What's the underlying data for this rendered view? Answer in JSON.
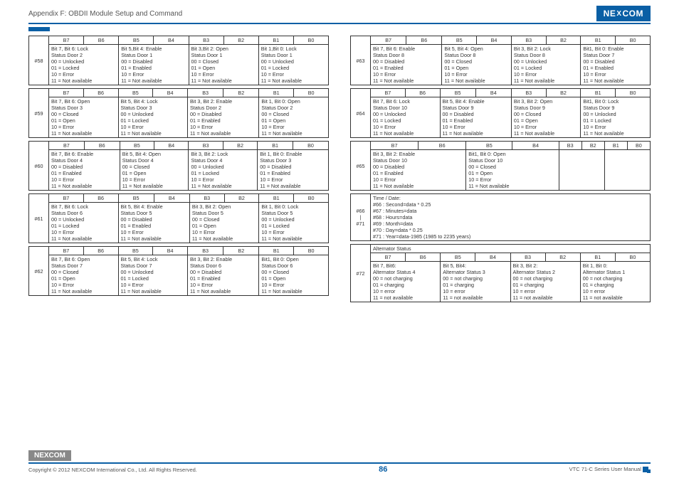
{
  "header": {
    "breadcrumb": "Appendix F: OBDII Module Setup and Command",
    "logo": "NE",
    "logo_mid": "X",
    "logo_end": "COM"
  },
  "footer": {
    "logo": "NEXCOM",
    "copyright": "Copyright © 2012 NEXCOM International Co., Ltd. All Rights Reserved.",
    "page": "86",
    "manual": "VTC 71-C Series User Manual"
  },
  "bithdr": [
    "B7",
    "B6",
    "B5",
    "B4",
    "B3",
    "B2",
    "B1",
    "B0"
  ],
  "left": [
    {
      "num": "#58",
      "cells": [
        "Bit 7, Bit 6: Lock\nStatus Door 2\n00 = Unlocked\n01 = Locked\n10 = Error\n11 = Not available",
        "Bit 5,Bit 4: Enable\nStatus Door 1\n00 = Disabled\n01 = Enabled\n10 = Error\n11 = Not available",
        "Bit 3,Bit 2: Open\nStatus Door 1\n00 = Closed\n01 = Open\n10 = Error\n11 = Not available",
        "Bit 1,Bit 0: Lock\nStatus Door 1\n00 = Unlocked\n01 = Locked\n10 = Error\n11 = Not available"
      ]
    },
    {
      "num": "#59",
      "cells": [
        "Bit 7, Bit 6: Open\nStatus Door 3\n00 = Closed\n01 = Open\n10 = Error\n11 = Not available",
        "Bit 5, Bit 4: Lock\nStatus Door 3\n00 = Unlocked\n01 = Locked\n10 = Error\n11 = Not available",
        "Bit 3, Bit 2: Enable\nStatus Door 2\n00 = Disabled\n01 = Enabled\n10 = Error\n11 = Not available",
        "Bit 1, Bit 0: Open\nStatus Door 2\n00 = Closed\n01 = Open\n10 = Error\n11 = Not available"
      ]
    },
    {
      "num": "#60",
      "cells": [
        "Bit 7, Bit 6: Enable\nStatus Door 4\n00 = Disabled\n01 = Enabled\n10 = Error\n11 = Not available",
        "Bit 5, Bit 4: Open\nStatus Door 4\n00 = Closed\n01 = Open\n10 = Error\n11 = Not available",
        "Bit 3, Bit 2: Lock\nStatus Door 4\n00 = Unlocked\n01 = Locked\n10 = Error\n11 = Not available",
        "Bit 1, Bit 0: Enable\nStatus Door 3\n00 = Disabled\n01 = Enabled\n10 = Error\n11 = Not available"
      ]
    },
    {
      "num": "#61",
      "cells": [
        "Bit 7, Bit 6: Lock\nStatus Door 6\n00 = Unlocked\n01 = Locked\n10 = Error\n11 = Not available",
        "Bit 5, Bit 4: Enable\nStatus Door 5\n00 = Disabled\n01 = Enabled\n10 = Error\n11 = Not available",
        "Bit 3, Bit 2: Open\nStatus Door 5\n00 = Closed\n01 = Open\n10 = Error\n11 = Not available",
        "Bit 1, Bit 0: Lock\nStatus Door 5\n00 = Unlocked\n01 = Locked\n10 = Error\n11 = Not available"
      ]
    },
    {
      "num": "#62",
      "cells": [
        "Bit 7, Bit 6: Open\nStatus Door 7\n00 = Closed\n01 = Open\n10 = Error\n11 = Not available",
        "Bit 5, Bit 4: Lock\nStatus Door 7\n00 = Unlocked\n01 = Locked\n10 = Error\n11 = Not available",
        "Bit 3, Bit 2: Enable\nStatus Door 6\n00 = Disabled\n01 = Enabled\n10 = Error\n11 = Not available",
        "Bit1, Bit 0: Open\nStatus Door 6\n00 = Closed\n01 = Open\n10 = Error\n11 = Not available"
      ]
    }
  ],
  "right": [
    {
      "num": "#63",
      "cells": [
        "Bit 7, Bit 6: Enable\nStatus Door 8\n00 = Disabled\n01 = Enabled\n10 = Error\n11 = Not available",
        "Bit 5, Bit 4: Open\nStatus Door 8\n00 = Closed\n01 = Open\n10 = Error\n11 = Not available",
        "Bit 3, Bit 2: Lock\nStatus Door 8\n00 = Unlocked\n01 = Locked\n10 = Error\n11 = Not available",
        "Bit1, Bit 0: Enable\nStatus Door 7\n00 = Disabled\n01 = Enabled\n10 = Error\n11 = Not available"
      ]
    },
    {
      "num": "#64",
      "cells": [
        "Bit 7, Bit 6: Lock\nStatus Door 10\n00 = Unlocked\n01 = Locked\n10 = Error\n11 = Not available",
        "Bit 5, Bit 4: Enable\nStatus Door 9\n00 = Disabled\n01 = Enabled\n10 = Error\n11 = Not available",
        "Bit 3, Bit 2: Open\nStatus Door 9\n00 = Closed\n01 = Open\n10 = Error\n11 = Not available",
        "Bit1, Bit 0: Lock\nStatus Door 9\n00 = Unlocked\n01 = Locked\n10 = Error\n11 = Not available"
      ]
    },
    {
      "num": "#65",
      "cells": [
        "Bit 3, Bit 2: Enable\nStatus Door 10\n00 = Disabled\n01 = Enabled\n10 = Error\n11 = Not available",
        "Bit1, Bit 0: Open\nStatus Door 10\n00 = Closed\n01 = Open\n10 = Error\n11 = Not available",
        "",
        ""
      ]
    },
    {
      "num": "#66\n|\n#71",
      "free": "Time / Date:\n#66 : Second=data * 0.25\n#67 : Minutes=data\n#68 : Hours=data\n#69 : Month=data\n#70 : Day=data * 0.25\n#71 : Year=data-1985 (1985 to 2235 years)"
    },
    {
      "num": "#72",
      "title": "Alternator Status",
      "cells": [
        "Bit 7, Bit6:\nAlternator Status 4\n00 = not charging\n01 = charging\n10 = error\n11 = not available",
        "Bit 5, Bit4:\nAlternator Status 3\n00 = not charging\n01 = charging\n10 = error\n11 = not available",
        "Bit 3, Bit 2:\nAlternator Status 2\n00 = not charging\n01 = charging\n10 = error\n11 = not available",
        "Bit 1, Bit 0:\nAlternator Status 1\n00 = not charging\n01 = charging\n10 = error\n11 = not available"
      ]
    }
  ]
}
